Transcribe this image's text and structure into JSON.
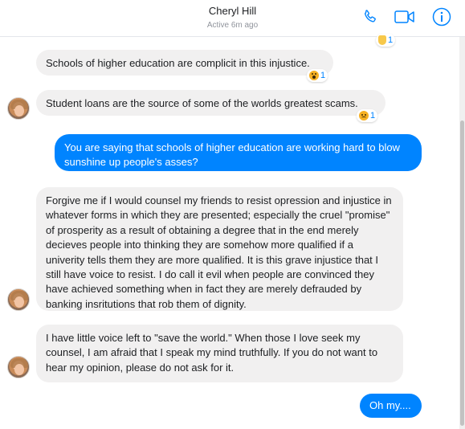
{
  "header": {
    "name": "Cheryl Hill",
    "status": "Active 6m ago",
    "icons": [
      "phone-icon",
      "video-call-icon",
      "info-icon"
    ],
    "accent_color": "#0084ff"
  },
  "messages": [
    {
      "id": "m1",
      "direction": "incoming",
      "text": "Schools of higher education are complicit in this injustice.",
      "reaction": {
        "emoji": "wow",
        "count": "1"
      }
    },
    {
      "id": "m2",
      "direction": "incoming",
      "text": "Student loans are the source of some of the worlds greatest scams.",
      "reaction": {
        "emoji": "sad",
        "count": "1"
      }
    },
    {
      "id": "m3",
      "direction": "outgoing",
      "text": "You are saying that schools of higher education are working hard to blow sunshine up people's asses?"
    },
    {
      "id": "m4",
      "direction": "incoming",
      "text": "Forgive me if I would counsel my friends to resist opression and injustice in whatever forms in which they are presented; especially the cruel \"promise\" of prosperity as a result of obtaining a degree that in the end merely decieves people into thinking they are somehow more qualified if a univerity tells them they are more qualified.  It is this grave injustice that I still have voice to resist.  I do call it evil when people are convinced they have achieved something when in fact they are merely defrauded by banking insritutions that rob them of dignity."
    },
    {
      "id": "m5",
      "direction": "incoming",
      "text": "I have little voice left to \"save the world.\"  When those I love seek my counsel, I am afraid that I speak my mind truthfully.  If you do not want to hear my opinion, please do not ask for it."
    },
    {
      "id": "m6",
      "direction": "outgoing",
      "text": "Oh my...."
    }
  ],
  "top_reaction": {
    "emoji": "thumbs-up",
    "count": "1"
  }
}
